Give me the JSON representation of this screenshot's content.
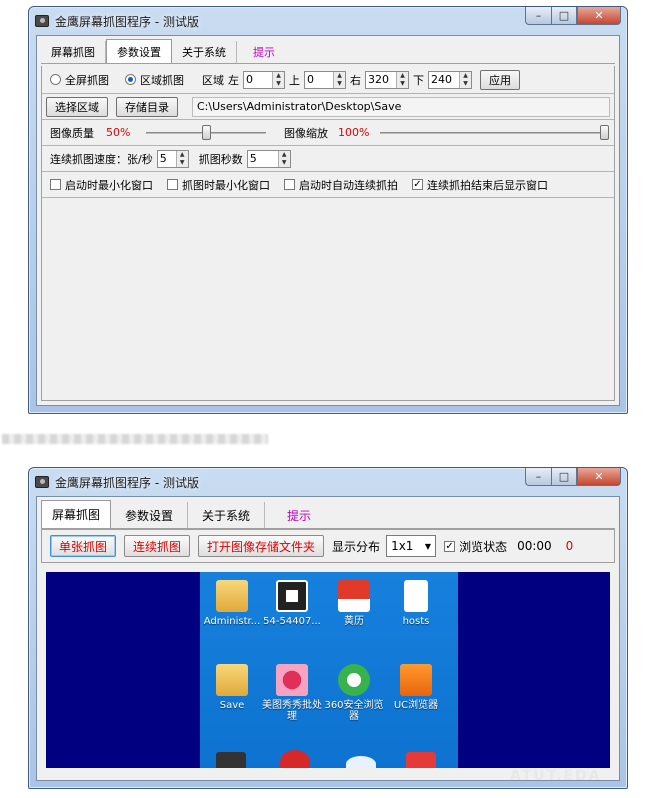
{
  "top_window": {
    "title": "金鹰屏幕抓图程序 - 测试版",
    "controls": {
      "minimize": "–",
      "maximize": "□",
      "close": "✕"
    },
    "tabs": [
      {
        "label": "屏幕抓图"
      },
      {
        "label": "参数设置"
      },
      {
        "label": "关于系统"
      },
      {
        "label": "提示"
      }
    ],
    "capture_mode": {
      "full_label": "全屏抓图",
      "region_label": "区域抓图",
      "selected": "区域抓图"
    },
    "region": {
      "label": "区域",
      "left_label": "左",
      "left_value": "0",
      "top_label": "上",
      "top_value": "0",
      "right_label": "右",
      "right_value": "320",
      "bottom_label": "下",
      "bottom_value": "240",
      "apply_label": "应用"
    },
    "select_area_label": "选择区域",
    "save_dir_label": "存储目录",
    "save_path": "C:\\Users\\Administrator\\Desktop\\Save",
    "quality": {
      "label": "图像质量",
      "value_text": "50%",
      "fraction": 0.5
    },
    "scale": {
      "label": "图像缩放",
      "value_text": "100%",
      "fraction": 1.0
    },
    "speed": {
      "label": "连续抓图速度：张/秒",
      "value": "5"
    },
    "seconds": {
      "label": "抓图秒数",
      "value": "5"
    },
    "options": [
      {
        "label": "启动时最小化窗口",
        "checked": false
      },
      {
        "label": "抓图时最小化窗口",
        "checked": false
      },
      {
        "label": "启动时自动连续抓拍",
        "checked": false
      },
      {
        "label": "连续抓拍结束后显示窗口",
        "checked": true
      }
    ]
  },
  "bottom_window": {
    "title": "金鹰屏幕抓图程序 - 测试版",
    "tabs": [
      {
        "label": "屏幕抓图"
      },
      {
        "label": "参数设置"
      },
      {
        "label": "关于系统"
      },
      {
        "label": "提示"
      }
    ],
    "toolbar": {
      "single_capture": "单张抓图",
      "continuous_capture": "连续抓图",
      "open_folder": "打开图像存储文件夹",
      "layout_label": "显示分布",
      "layout_value": "1x1",
      "browse_label": "浏览状态",
      "browse_checked": true,
      "time": "00:00",
      "count": "0"
    },
    "desktop_icons": [
      {
        "label": "Administr...",
        "kind": "user-folder"
      },
      {
        "label": "54-54407...",
        "kind": "image-file"
      },
      {
        "label": "黄历",
        "kind": "app"
      },
      {
        "label": "hosts",
        "kind": "document"
      },
      {
        "label": "Save",
        "kind": "folder"
      },
      {
        "label": "美图秀秀批处理",
        "kind": "app"
      },
      {
        "label": "360安全浏览器",
        "kind": "browser"
      },
      {
        "label": "UC浏览器",
        "kind": "browser"
      }
    ]
  },
  "watermark": "ATUT.EDA"
}
